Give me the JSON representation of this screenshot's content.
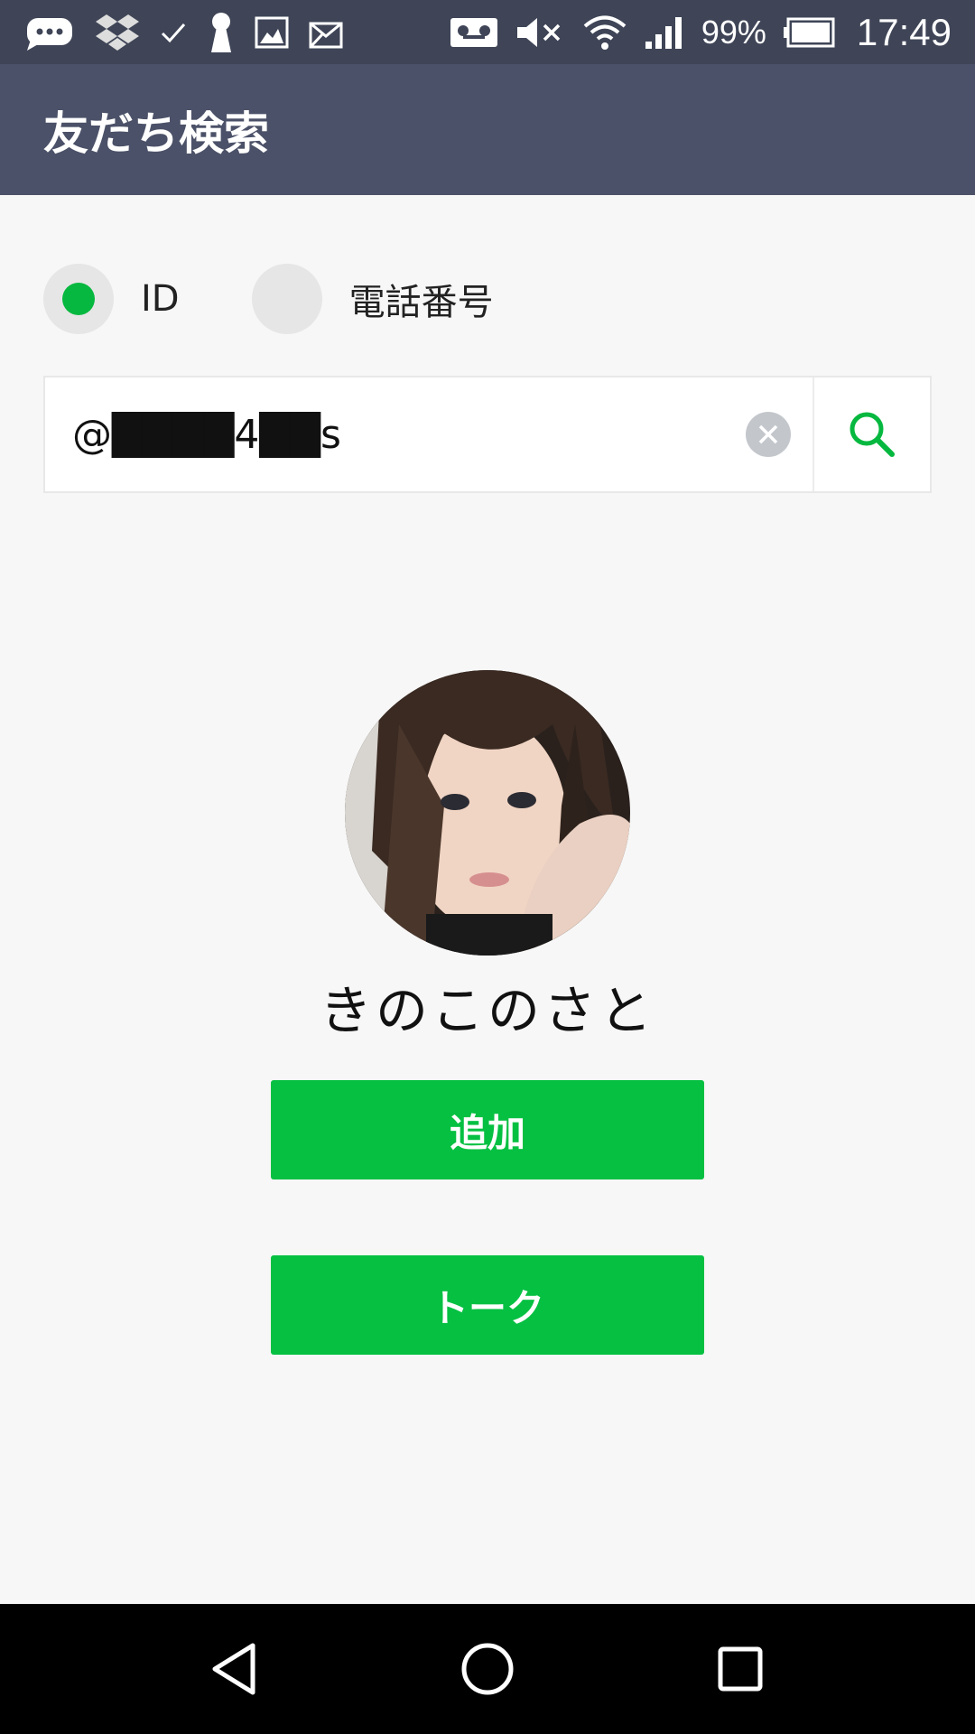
{
  "status_bar": {
    "icons": [
      "chat-bubble-icon",
      "dropbox-icon",
      "check-icon",
      "keyhole-icon",
      "image-icon",
      "mail-icon",
      "voicemail-icon",
      "mute-icon",
      "wifi-icon",
      "signal-icon",
      "battery-icon"
    ],
    "battery_percent": "99%",
    "time": "17:49"
  },
  "header": {
    "title": "友だち検索"
  },
  "search_type": {
    "options": [
      {
        "label": "ID",
        "selected": true
      },
      {
        "label": "電話番号",
        "selected": false
      }
    ]
  },
  "search": {
    "value": "@████4██s"
  },
  "profile": {
    "name": "きのこのさと"
  },
  "actions": {
    "add_label": "追加",
    "talk_label": "トーク"
  },
  "nav": {
    "items": [
      "back-icon",
      "home-icon",
      "recents-icon"
    ]
  },
  "colors": {
    "status_bar": "#3f4557",
    "header": "#4b5168",
    "accent_green": "#06c042",
    "background": "#f7f7f7"
  }
}
